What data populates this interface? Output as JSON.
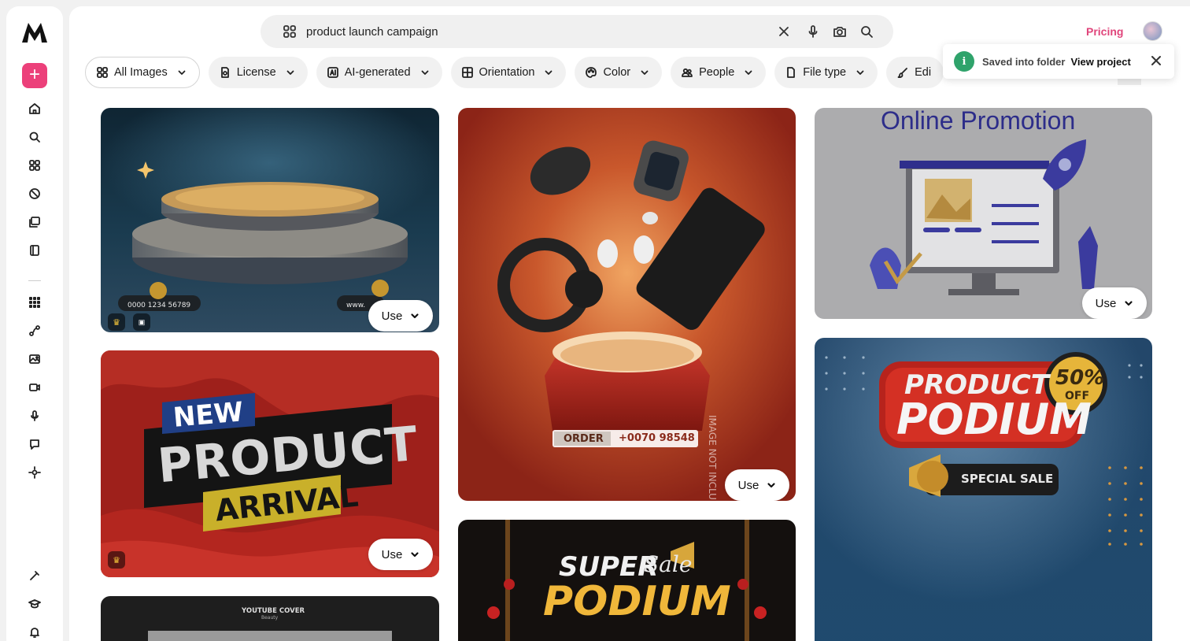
{
  "search": {
    "query": "product launch campaign",
    "icons": [
      "apps-icon",
      "clear-icon",
      "microphone-icon",
      "camera-icon",
      "search-icon"
    ]
  },
  "header": {
    "pricing_label": "Pricing"
  },
  "filters": [
    {
      "label": "All Images",
      "icon": "apps-icon"
    },
    {
      "label": "License",
      "icon": "license-icon"
    },
    {
      "label": "AI-generated",
      "icon": "ai-icon"
    },
    {
      "label": "Orientation",
      "icon": "orientation-icon"
    },
    {
      "label": "Color",
      "icon": "palette-icon"
    },
    {
      "label": "People",
      "icon": "people-icon"
    },
    {
      "label": "File type",
      "icon": "file-icon"
    },
    {
      "label": "Edi",
      "icon": "brush-icon"
    }
  ],
  "toast": {
    "message": "Saved into folder",
    "link_label": "View project"
  },
  "sidebar": {
    "items": [
      "home",
      "search",
      "apps",
      "assets",
      "collections",
      "library",
      "grid-apps",
      "path-tool",
      "image-tool",
      "video-tool",
      "voice-tool",
      "chat-tool",
      "hub-tool",
      "plugin",
      "learn",
      "notifications"
    ]
  },
  "results": {
    "use_label": "Use",
    "cards": [
      {
        "name": "podium-dark",
        "texts": {
          "phone": "0000 1234 56789",
          "web": "www."
        }
      },
      {
        "name": "new-product-arrival",
        "texts": {
          "new": "NEW",
          "product": "PRODUCT",
          "arrival": "ARRIVAL"
        }
      },
      {
        "name": "youtube-cover",
        "texts": {
          "title": "YOUTUBE COVER",
          "sub": "Beauty"
        }
      },
      {
        "name": "gadgets-box",
        "texts": {
          "order": "ORDER",
          "phone": "+0070 98548",
          "side": "IMAGE NOT INCLU"
        }
      },
      {
        "name": "super-sale-podium",
        "texts": {
          "super": "SUPER",
          "sale": "Sale",
          "podium": "PODIUM"
        }
      },
      {
        "name": "online-promotion",
        "texts": {
          "title": "Online Promotion"
        }
      },
      {
        "name": "product-podium-sale",
        "texts": {
          "product": "PRODUCT",
          "podium": "PODIUM",
          "percent": "50%",
          "off": "OFF",
          "special": "SPECIAL SALE"
        }
      }
    ]
  }
}
